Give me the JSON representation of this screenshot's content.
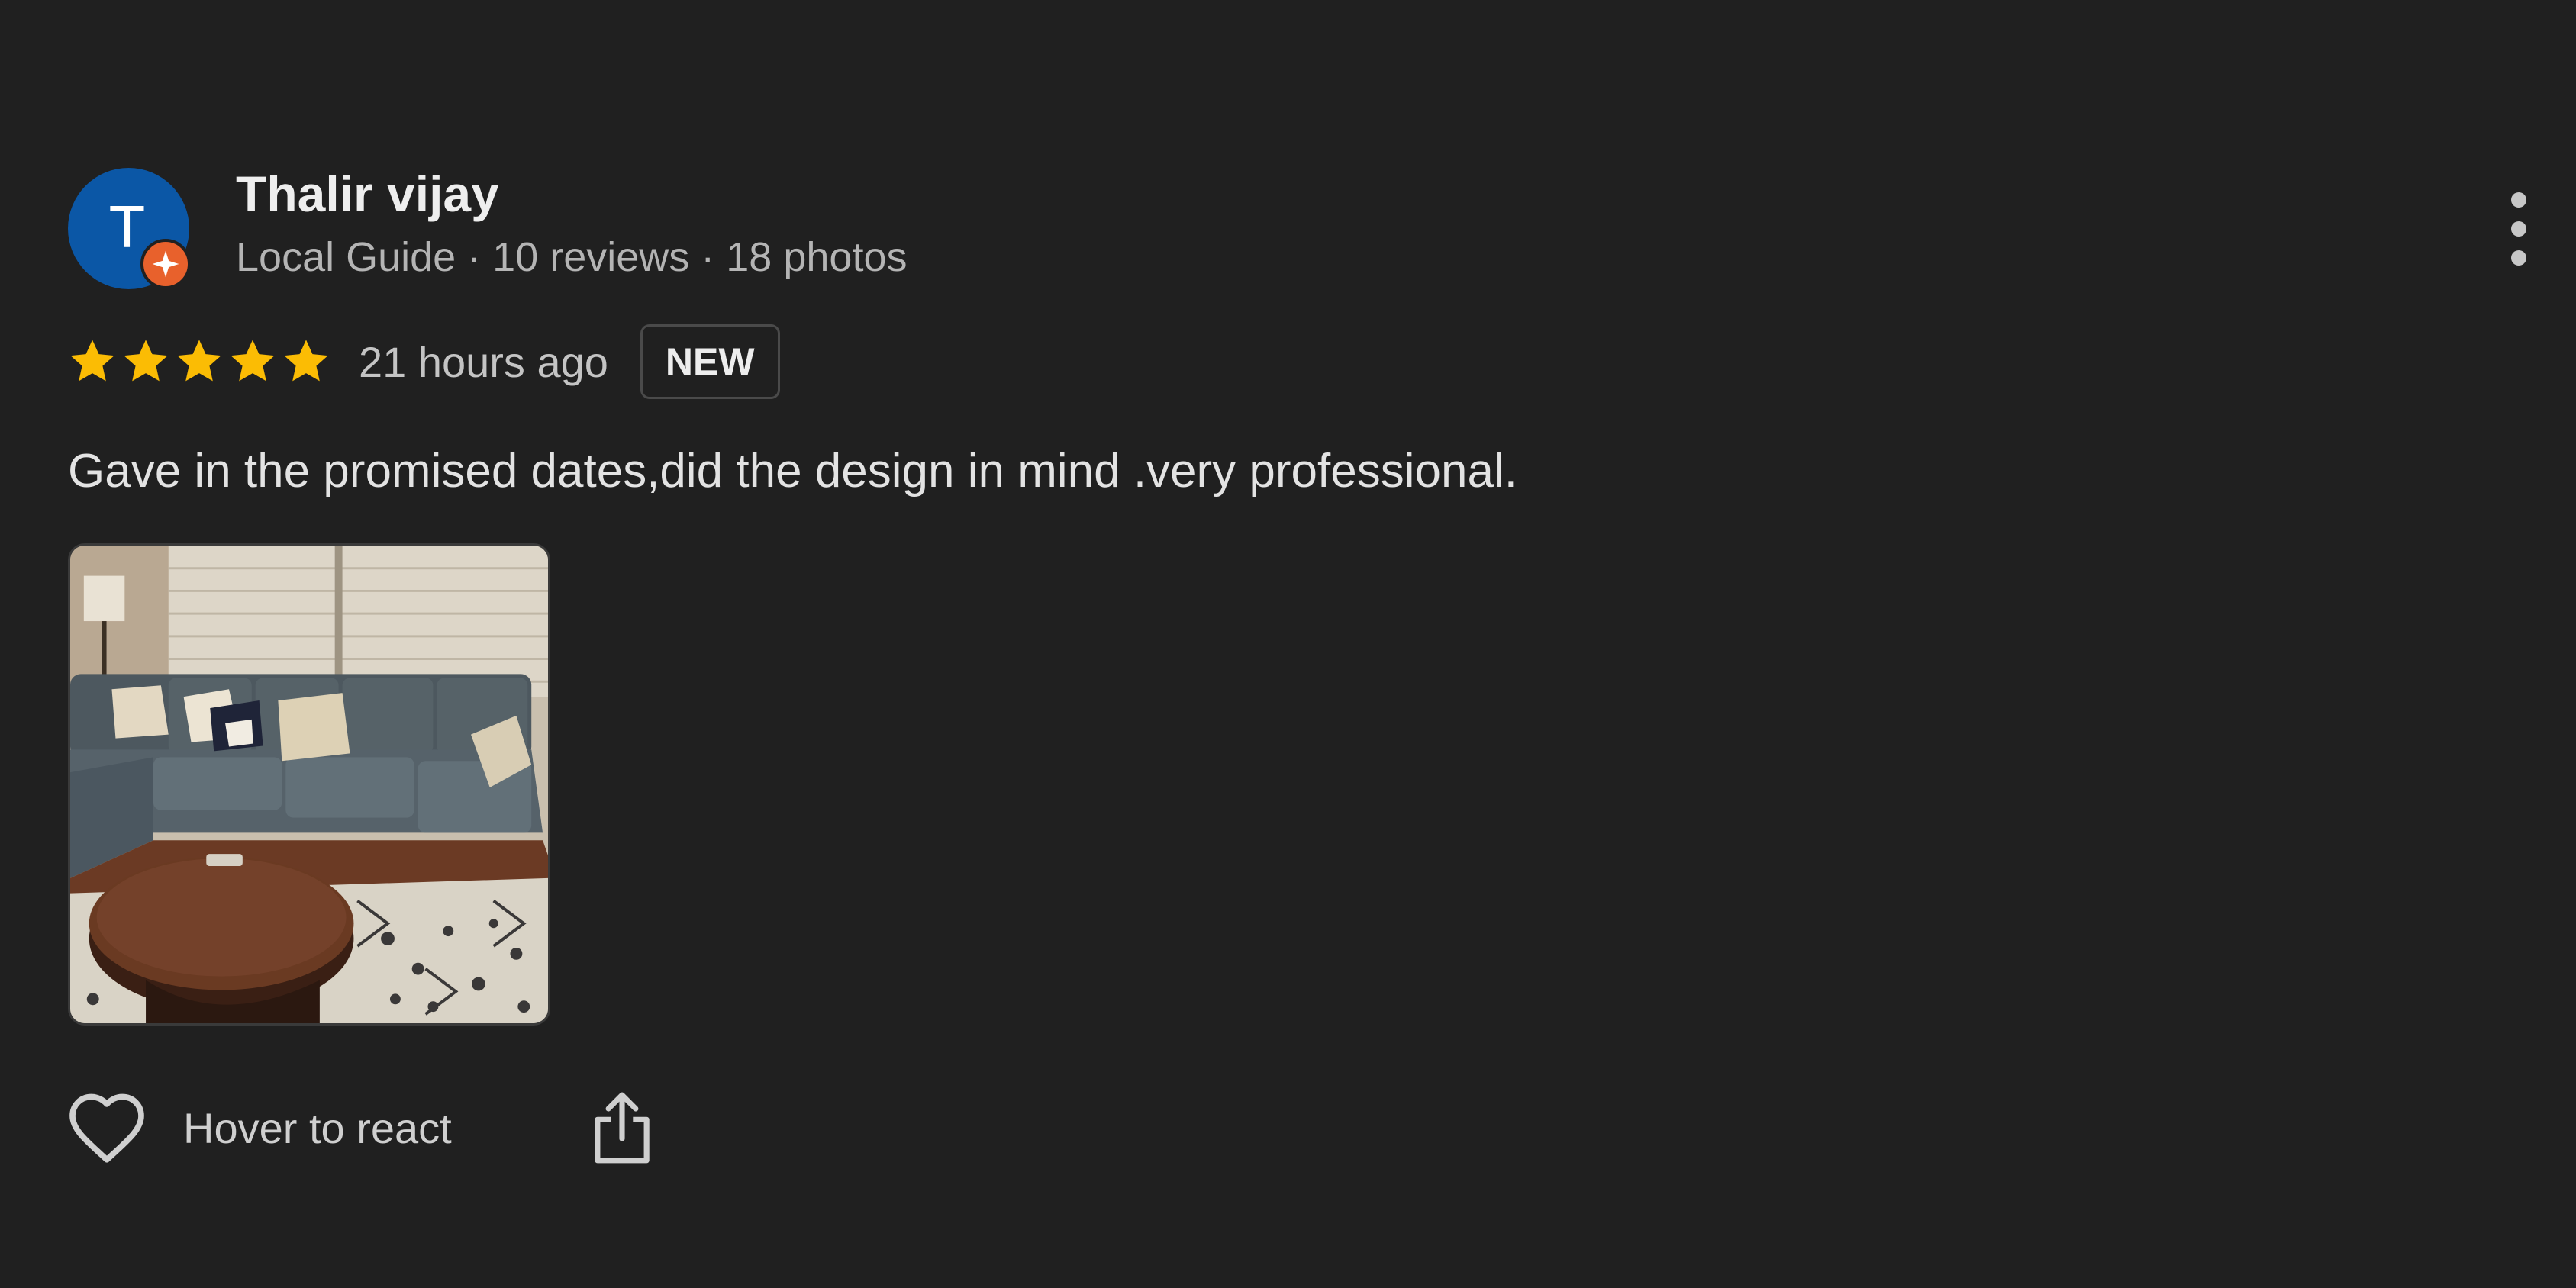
{
  "review": {
    "reviewer": {
      "avatar_letter": "T",
      "name": "Thalir vijay",
      "meta": "Local Guide · 10 reviews · 18 photos"
    },
    "rating": 5,
    "time_ago": "21 hours ago",
    "badge": "NEW",
    "text": "Gave in the promised dates,did the design in mind .very professional.",
    "photo_alt": "Review photo",
    "actions": {
      "react_label": "Hover to react"
    }
  },
  "colors": {
    "background": "#202020",
    "avatar": "#0b57a6",
    "local_guide_badge": "#e8612c",
    "star": "#fbbc04"
  },
  "icons": {
    "more": "more-vertical-icon",
    "heart": "heart-outline-icon",
    "share": "share-icon",
    "star": "star-icon",
    "guide": "local-guide-icon"
  }
}
